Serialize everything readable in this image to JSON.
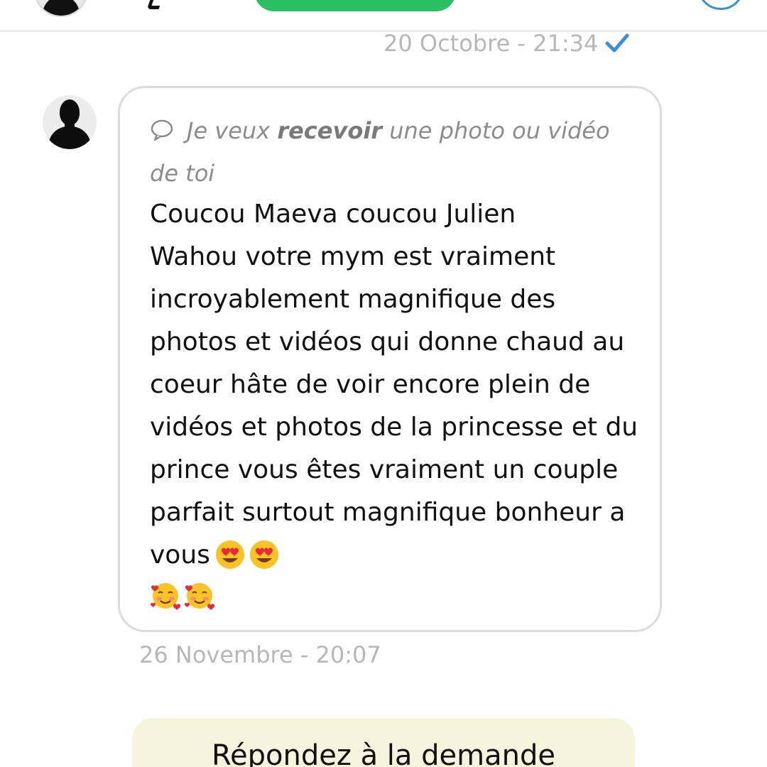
{
  "header": {
    "name_fragment": "",
    "green_button_label": ""
  },
  "thread": {
    "sent_timestamp": "20 Octobre - 21:34",
    "received_timestamp": "26 Novembre - 20:07"
  },
  "message": {
    "request_prefix": "Je veux ",
    "request_bold": "recevoir",
    "request_suffix": " une photo ou vidéo de toi",
    "body": "Coucou Maeva coucou Julien\nWahou votre mym est vraiment incroyablement magnifique des photos et vidéos qui donne chaud au coeur hâte de voir encore plein de vidéos et photos de la princesse et du prince vous êtes vraiment un couple parfait surtout magnifique bonheur a vous",
    "inline_emojis": [
      "heart-eyes-emoji",
      "heart-eyes-emoji"
    ],
    "trailing_emojis": [
      "smiling-face-with-hearts-emoji",
      "smiling-face-with-hearts-emoji"
    ]
  },
  "reply": {
    "label": "Répondez à la demande"
  },
  "colors": {
    "accent_green": "#2cbe62",
    "accent_blue": "#3b8fd9",
    "reply_background": "#f5f5dd",
    "timestamp_gray": "#b7b7b7"
  },
  "icons": {
    "read_receipt": "checkmark-icon",
    "request_type": "comment-icon"
  }
}
